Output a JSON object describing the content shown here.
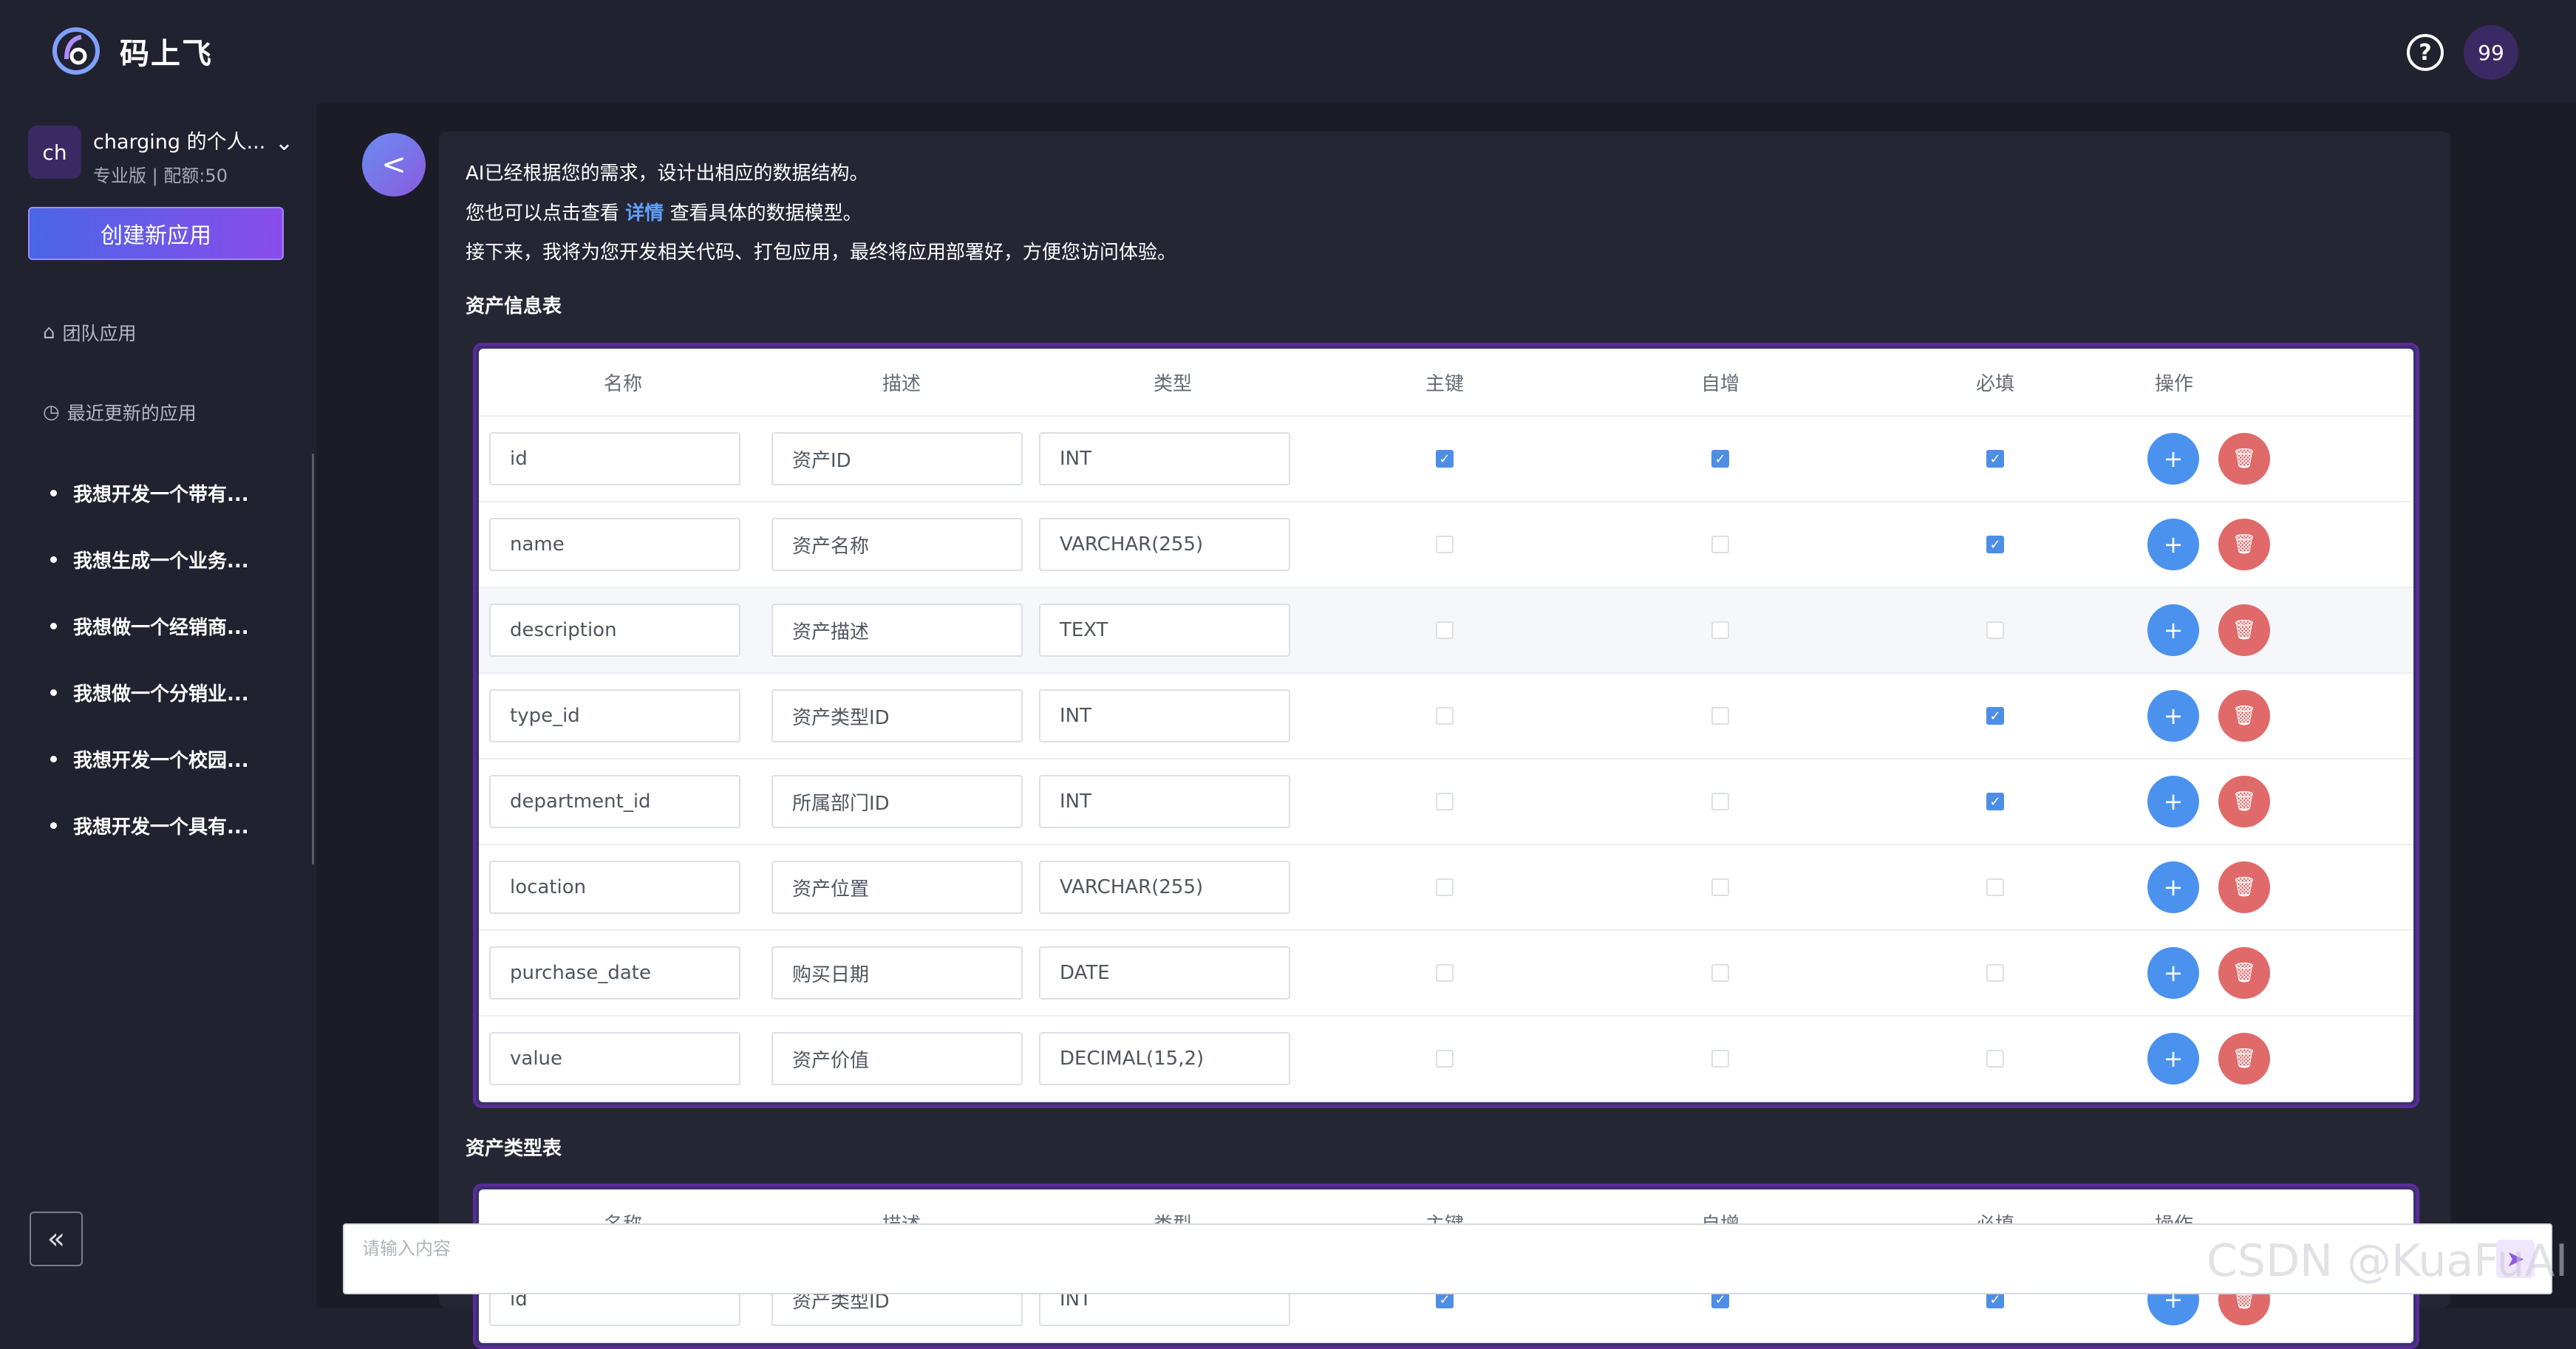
{
  "app": {
    "brand": "码上飞"
  },
  "header": {
    "avatar_label": "99",
    "help_icon": "?"
  },
  "sidebar": {
    "team_avatar": "ch",
    "team_name": "charging 的个人...",
    "team_meta": "专业版 | 配额:50",
    "create_button": "创建新应用",
    "nav_team": "团队应用",
    "nav_recent": "最近更新的应用",
    "recent_apps": [
      "我想开发一个带有...",
      "我想生成一个业务...",
      "我想做一个经销商...",
      "我想做一个分销业...",
      "我想开发一个校园...",
      "我想开发一个具有..."
    ],
    "collapse_icon": "«"
  },
  "message": {
    "line1": "AI已经根据您的需求，设计出相应的数据结构。",
    "line2_pre": "您也可以点击查看",
    "line2_link": "详情",
    "line2_post": "查看具体的数据模型。",
    "line3": "接下来，我将为您开发相关代码、打包应用，最终将应用部署好，方便您访问体验。"
  },
  "tables": [
    {
      "title": "资产信息表",
      "headers": [
        "名称",
        "描述",
        "类型",
        "主键",
        "自增",
        "必填",
        "操作"
      ],
      "rows": [
        {
          "name": "id",
          "desc": "资产ID",
          "type": "INT",
          "pk": true,
          "ai": true,
          "req": true
        },
        {
          "name": "name",
          "desc": "资产名称",
          "type": "VARCHAR(255)",
          "pk": false,
          "ai": false,
          "req": true
        },
        {
          "name": "description",
          "desc": "资产描述",
          "type": "TEXT",
          "pk": false,
          "ai": false,
          "req": false
        },
        {
          "name": "type_id",
          "desc": "资产类型ID",
          "type": "INT",
          "pk": false,
          "ai": false,
          "req": true
        },
        {
          "name": "department_id",
          "desc": "所属部门ID",
          "type": "INT",
          "pk": false,
          "ai": false,
          "req": true
        },
        {
          "name": "location",
          "desc": "资产位置",
          "type": "VARCHAR(255)",
          "pk": false,
          "ai": false,
          "req": false
        },
        {
          "name": "purchase_date",
          "desc": "购买日期",
          "type": "DATE",
          "pk": false,
          "ai": false,
          "req": false
        },
        {
          "name": "value",
          "desc": "资产价值",
          "type": "DECIMAL(15,2)",
          "pk": false,
          "ai": false,
          "req": false
        }
      ]
    },
    {
      "title": "资产类型表",
      "headers": [
        "名称",
        "描述",
        "类型",
        "主键",
        "自增",
        "必填",
        "操作"
      ],
      "rows": [
        {
          "name": "id",
          "desc": "资产类型ID",
          "type": "INT",
          "pk": true,
          "ai": true,
          "req": true
        }
      ]
    }
  ],
  "input": {
    "placeholder": "请输入内容"
  },
  "watermark": "CSDN @KuaFuAI"
}
